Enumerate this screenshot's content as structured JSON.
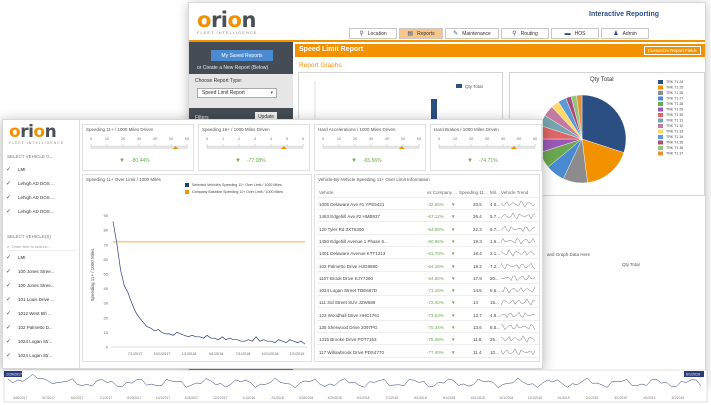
{
  "brand": {
    "word_pre": "",
    "word_o1": "o",
    "word_mid": "ri",
    "word_o2": "o",
    "word_post": "n",
    "sub": "FLEET INTELLIGENCE"
  },
  "colors": {
    "accent": "#f39200",
    "navy": "#2b4f83",
    "green": "#6aa84f",
    "sidebar": "#454c55"
  },
  "back": {
    "title": "Interactive Reporting",
    "nav": [
      {
        "icon": "location-pin-icon",
        "glyph": "⚲",
        "label": "Location",
        "active": false
      },
      {
        "icon": "reports-icon",
        "glyph": "▤",
        "label": "Reports",
        "active": true
      },
      {
        "icon": "maintenance-icon",
        "glyph": "✎",
        "label": "Maintenance",
        "active": false
      },
      {
        "icon": "routing-icon",
        "glyph": "⚲",
        "label": "Routing",
        "active": false
      },
      {
        "icon": "hos-icon",
        "glyph": "▬",
        "label": "HOS",
        "active": false
      },
      {
        "icon": "admin-icon",
        "glyph": "♟",
        "label": "Admin",
        "active": false
      }
    ],
    "saved_reports": "My Saved Reports",
    "create_new": "or Create a New Report (Below)",
    "choose_label": "Choose Report Type:",
    "report_type": "Speed Limit Report",
    "filters": "Filters",
    "update": "Update",
    "page_title": "Speed Limit Report",
    "customize": "Customize Report Fields",
    "graphs": "Report Graphs",
    "bar_legend": "Qty Total",
    "pie_title": "Qty Total",
    "pie_legend": [
      "TRK T1 24",
      "TRK T1 25",
      "TRK T1 26",
      "TRK T1 27",
      "TRK T1 28",
      "TRK T1 29",
      "TRK T1 30",
      "TRK T1 31",
      "TRK T1 32",
      "TRK T1 33",
      "TRK T1 34",
      "TRK T1 35",
      "TRK T1 36",
      "TRK T1 37"
    ],
    "drop_text": "and Graph Data Here",
    "qty_total": "Qty Total"
  },
  "front": {
    "select_group": "SELECT VEHICLE G...",
    "groups": [
      "LMI",
      "Lehigh AD DOS ...",
      "Lehigh AD DOS ...",
      "Lehigh AD DOS ..."
    ],
    "select_vehicles": "SELECT VEHICLE(S)",
    "search_placeholder": "Enter text to search...",
    "vehicles": [
      "LMI",
      "100 Jones Stree...",
      "100 Jones Stree...",
      "101 Louis Drive ...",
      "1012 West 5th ...",
      "102 Palmetto D...",
      "1024 Logan Str...",
      "1024 Logan Str..."
    ],
    "kpis": [
      {
        "title": "Speeding 11+ / 1000 Miles Driven",
        "ticks": [
          "0",
          "10",
          "20",
          "30",
          "40",
          "50",
          "60"
        ],
        "value": "-80.44%",
        "marker": 0.88
      },
      {
        "title": "Speeding 16+ / 1000 Miles Driven",
        "ticks": [
          "0",
          "1",
          "2",
          "3",
          "4",
          "5",
          "6"
        ],
        "value": "-77.08%",
        "marker": 0.8
      },
      {
        "title": "Hard Accelerations / 1000 Miles Driven",
        "ticks": [
          "0",
          "10",
          "20",
          "30",
          "40",
          "50",
          "60"
        ],
        "value": "-65.56%",
        "marker": 0.82
      },
      {
        "title": "Hard Brakes / 1000 Miles Driven",
        "ticks": [
          "0",
          "10",
          "20",
          "30",
          "40",
          "50",
          "60"
        ],
        "value": "-74.71%",
        "marker": 0.78
      }
    ],
    "line_card_title": "Speeding 11+ Over Limit / 1000 Miles",
    "table_card_title": "Vehicle-By-Vehicle Speeding 11+ Over Limit Information"
  },
  "chart_data": {
    "type": "line",
    "title": "",
    "ylabel": "Speeding 11+ / 1000 Miles",
    "ylim": [
      0,
      100
    ],
    "yticks": [
      "0",
      "10",
      "20",
      "30",
      "40",
      "50",
      "60",
      "70",
      "80",
      "90"
    ],
    "xticks": [
      "7/1/2017",
      "10/1/2017",
      "1/1/2018",
      "4/1/2018",
      "7/1/2018",
      "10/1/2018",
      "1/1/2019"
    ],
    "series": [
      {
        "name": "Selected Vehicle's Speeding 11+ Over Limit / 1000 Miles",
        "color": "#2b3b7a",
        "values": [
          86,
          71,
          53,
          42,
          37,
          30,
          24,
          20,
          17,
          14,
          13,
          11,
          12,
          10,
          9,
          9,
          8,
          10,
          9,
          8,
          7,
          8,
          7,
          7,
          6,
          8,
          6,
          6,
          5,
          7,
          5,
          6,
          5,
          5,
          4,
          4,
          5,
          4,
          7,
          4,
          5,
          4,
          4,
          3,
          5,
          4,
          3,
          5,
          4,
          3,
          4,
          2
        ]
      },
      {
        "name": "Company Baseline Speeding 11+ Over Limit / 1000 Miles",
        "color": "#f39200",
        "values": [
          72,
          72
        ]
      }
    ],
    "legend": "top-right"
  },
  "table": {
    "headers": [
      "Vehicle",
      "vs Company ...",
      "Speeding 11...",
      "Mil...",
      "Vehicle Trend"
    ],
    "rows": [
      {
        "vehicle": "1005 Delaware Ave #1 YPE5421",
        "pct": "-32.65%",
        "spd": "33.5",
        "mi": "4.0..."
      },
      {
        "vehicle": "1463 Edgehill Ave #2 HMB937",
        "pct": "-67.12%",
        "spd": "26.4",
        "mi": "5.7..."
      },
      {
        "vehicle": "120 Tyler Rd 3XT6390",
        "pct": "-54.88%",
        "spd": "22.3",
        "mi": "5.7..."
      },
      {
        "vehicle": "1450 Edgehill Avenue 1 Phase 6...",
        "pct": "-60.96%",
        "spd": "19.3",
        "mi": "1.6..."
      },
      {
        "vehicle": "1401 Delaware Avenue KTT1213",
        "pct": "-61.78%",
        "spd": "18.4",
        "mi": "2.1..."
      },
      {
        "vehicle": "102 Palmetto Drive HJG9880",
        "pct": "-64.16%",
        "spd": "18.2",
        "mi": "7.2..."
      },
      {
        "vehicle": "1107 Brook Drive KJY7260",
        "pct": "-64.60%",
        "spd": "17.9",
        "mi": "20..."
      },
      {
        "vehicle": "1024 Logan Street TDE667D",
        "pct": "-71.15%",
        "spd": "14.5",
        "mi": "5.5..."
      },
      {
        "vehicle": "111 3rd Street SUV JZW689",
        "pct": "-72.40%",
        "spd": "14",
        "mi": "15..."
      },
      {
        "vehicle": "123 Woodhall Drive HHC1761",
        "pct": "-73.53%",
        "spd": "13.7",
        "mi": "4.8..."
      },
      {
        "vehicle": "135 Sherwood Drive 2097PG",
        "pct": "-75.34%",
        "spd": "13.6",
        "mi": "8.5..."
      },
      {
        "vehicle": "1315 Brooke Drive PDT7163",
        "pct": "-76.68%",
        "spd": "11.8",
        "mi": "25..."
      },
      {
        "vehicle": "117 Willowbrook Drive PDS4770",
        "pct": "-77.40%",
        "spd": "11.4",
        "mi": "10..."
      }
    ]
  },
  "timeline": {
    "start": "1/29/2017",
    "end": "6/1/2019",
    "ticks": [
      "3/26/2017",
      "5/7/2017",
      "6/1/2017",
      "7/1/2017",
      "8/29/2017",
      "10/1/2017",
      "11/5/2017",
      "12/1/2017",
      "1/1/2018",
      "2/1/2018",
      "3/18/2018",
      "4/29/2018",
      "6/1/2018",
      "7/1/2018",
      "8/1/2018",
      "9/1/2018",
      "10/1/2018",
      "11/1/2018",
      "12/1/2018",
      "1/1/2019",
      "2/1/2019",
      "3/1/2019",
      "4/1/2019",
      "5/1/2019"
    ]
  }
}
